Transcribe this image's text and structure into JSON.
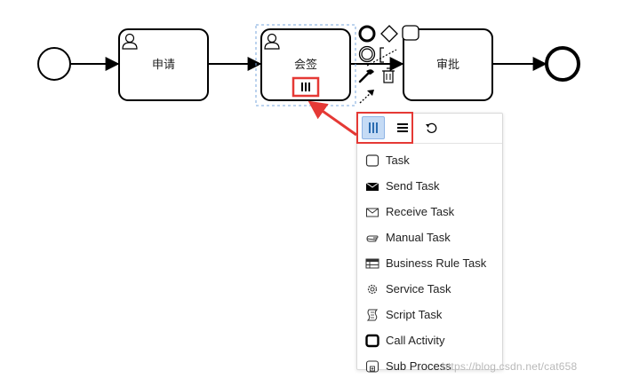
{
  "diagram": {
    "tasks": [
      {
        "id": "task-1",
        "label": "申请"
      },
      {
        "id": "task-2",
        "label": "会签"
      },
      {
        "id": "task-3",
        "label": "审批"
      }
    ]
  },
  "popup_menu": {
    "header_buttons": [
      {
        "name": "parallel-multi-instance",
        "icon": "parallel-bars-icon",
        "active": true
      },
      {
        "name": "sequential-multi-instance",
        "icon": "sequential-bars-icon",
        "active": false
      },
      {
        "name": "loop",
        "icon": "loop-icon",
        "active": false
      }
    ],
    "items": [
      {
        "label": "Task",
        "icon": "task-icon"
      },
      {
        "label": "Send Task",
        "icon": "send-envelope-icon"
      },
      {
        "label": "Receive Task",
        "icon": "receive-envelope-icon"
      },
      {
        "label": "Manual Task",
        "icon": "hand-icon"
      },
      {
        "label": "Business Rule Task",
        "icon": "table-icon"
      },
      {
        "label": "Service Task",
        "icon": "gear-icon"
      },
      {
        "label": "Script Task",
        "icon": "script-icon"
      },
      {
        "label": "Call Activity",
        "icon": "call-activity-icon"
      },
      {
        "label": "Sub Process",
        "icon": "sub-process-icon"
      }
    ]
  },
  "watermark": "https://blog.csdn.net/cat658",
  "colors": {
    "highlight": "#e53935",
    "selection": "#7aa7dc",
    "active_button": "#c5dbf5"
  }
}
